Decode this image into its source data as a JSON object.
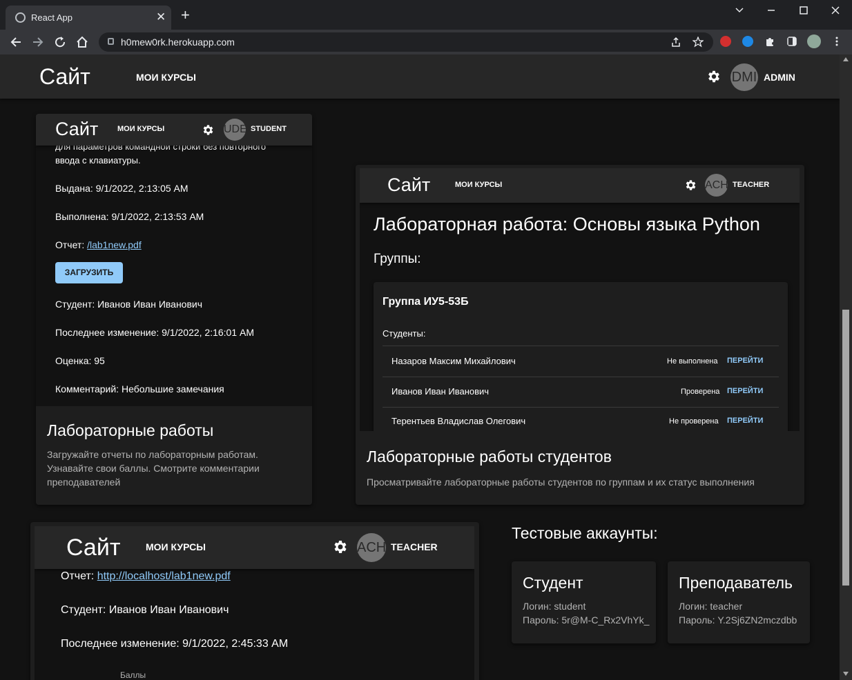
{
  "browser": {
    "tab_title": "React App",
    "tab_close": "✕",
    "new_tab": "+",
    "url": "h0mew0rk.herokuapp.com"
  },
  "header": {
    "logo": "Сайт",
    "nav": "МОИ КУРСЫ",
    "avatar": "DMI",
    "role": "ADMIN"
  },
  "student_card": {
    "header": {
      "logo": "Сайт",
      "nav": "МОИ КУРСЫ",
      "avatar": "UDE",
      "role": "STUDENT"
    },
    "desc_line1": "для параметров командной строки без повторного",
    "desc_line2": "ввода с клавиатуры.",
    "issued": "Выдана: 9/1/2022, 2:13:05 AM",
    "completed": "Выполнена: 9/1/2022, 2:13:53 AM",
    "report_label": "Отчет: ",
    "report_link": "/lab1new.pdf",
    "upload_button": "ЗАГРУЗИТЬ",
    "student": "Студент: Иванов Иван Иванович",
    "last_change": "Последнее изменение: 9/1/2022, 2:16:01 AM",
    "grade": "Оценка: 95",
    "comment": "Комментарий: Небольшие замечания",
    "title": "Лабораторные работы",
    "description": "Загружайте отчеты по лабораторным работам. Узнавайте свои баллы. Смотрите комментарии преподавателей"
  },
  "teacher_card": {
    "header": {
      "logo": "Сайт",
      "nav": "МОИ КУРСЫ",
      "avatar": "ACH",
      "role": "TEACHER"
    },
    "lab_title": "Лабораторная работа: Основы языка Python",
    "groups_label": "Группы:",
    "group_name": "Группа ИУ5-53Б",
    "students_label": "Студенты:",
    "students": [
      {
        "name": "Назаров Максим Михайлович",
        "status": "Не выполнена",
        "action": "ПЕРЕЙТИ"
      },
      {
        "name": "Иванов Иван Иванович",
        "status": "Проверена",
        "action": "ПЕРЕЙТИ"
      },
      {
        "name": "Терентьев Владислав Олегович",
        "status": "Не проверена",
        "action": "ПЕРЕЙТИ"
      }
    ],
    "title": "Лабораторные работы студентов",
    "description": "Просматривайте лабораторные работы студентов по группам и их статус выполнения"
  },
  "teacher_card2": {
    "header": {
      "logo": "Сайт",
      "nav": "МОИ КУРСЫ",
      "avatar": "ACH",
      "role": "TEACHER"
    },
    "report_label": "Отчет: ",
    "report_link": "http://localhost/lab1new.pdf",
    "student": "Студент: Иванов Иван Иванович",
    "last_change": "Последнее изменение: 9/1/2022, 2:45:33 AM",
    "points": "Баллы"
  },
  "test_accounts": {
    "heading": "Тестовые аккаунты:",
    "student": {
      "title": "Студент",
      "login": "Логин: student",
      "password": "Пароль: 5r@M-C_Rx2VhYk_"
    },
    "teacher": {
      "title": "Преподаватель",
      "login": "Логин: teacher",
      "password": "Пароль: Y.2Sj6ZN2mczdbb"
    }
  }
}
